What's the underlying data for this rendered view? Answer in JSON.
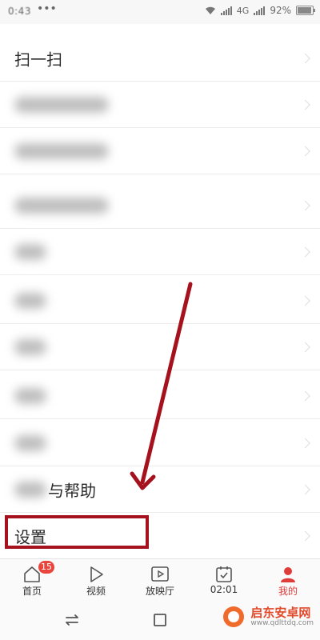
{
  "status": {
    "time": "0:43",
    "dots": "•••",
    "network": "4G",
    "battery": "92%",
    "battery_level": 0.92
  },
  "menu": [
    {
      "label": "扫一扫",
      "blurred": false
    },
    {
      "label": "",
      "blurred": true
    },
    {
      "label": "",
      "blurred": true
    },
    {
      "label": "",
      "blurred": true
    },
    {
      "label": "",
      "blurred": true
    },
    {
      "label": "",
      "blurred": true
    },
    {
      "label": "",
      "blurred": true
    },
    {
      "label": "",
      "blurred": true
    },
    {
      "label": "",
      "blurred": true
    },
    {
      "label": "与帮助",
      "blurred": true
    },
    {
      "label": "设置",
      "blurred": false
    }
  ],
  "tabs": [
    {
      "label": "首页",
      "icon": "home-icon",
      "badge": "15"
    },
    {
      "label": "视频",
      "icon": "play-icon"
    },
    {
      "label": "放映厅",
      "icon": "play-box-icon"
    },
    {
      "label": "02:01",
      "icon": "calendar-check-icon"
    },
    {
      "label": "我的",
      "icon": "person-icon",
      "active": true
    }
  ],
  "colors": {
    "accent": "#e03b3b",
    "highlight": "#a5121d",
    "arrow": "#a5121d"
  },
  "watermark": {
    "title": "启东安卓网",
    "url": "www.qdlttdq.com"
  }
}
